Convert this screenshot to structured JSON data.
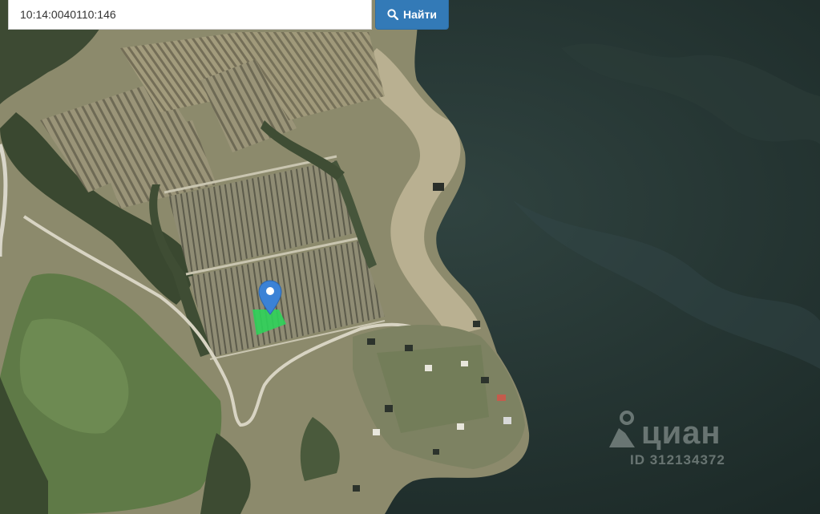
{
  "search": {
    "value": "10:14:0040110:146",
    "button_label": "Найти",
    "button_icon": "search-icon",
    "button_color": "#337ab7"
  },
  "map": {
    "view": "satellite",
    "marker_icon": "map-pin-icon",
    "marker_color": "#3b82d6",
    "parcel_color": "#2fd35a"
  },
  "watermark": {
    "brand": "циан",
    "listing_id": "ID 312134372"
  }
}
